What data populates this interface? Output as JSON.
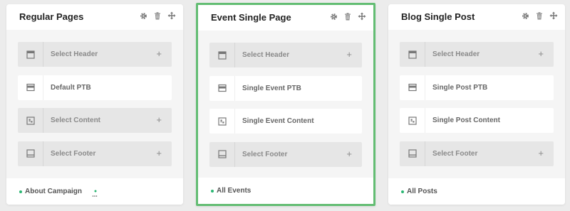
{
  "accent_color": "#63bd73",
  "link_dot_color": "#2bb673",
  "cards": [
    {
      "title": "Regular Pages",
      "rows": [
        {
          "label": "Select Header",
          "state": "empty",
          "icon": "header-layout-icon"
        },
        {
          "label": "Default PTB",
          "state": "filled",
          "icon": "ptb-layout-icon"
        },
        {
          "label": "Select Content",
          "state": "empty",
          "icon": "content-layout-icon"
        },
        {
          "label": "Select Footer",
          "state": "empty",
          "icon": "footer-layout-icon"
        }
      ],
      "footer_link": "About Campaign",
      "plus": "+"
    },
    {
      "title": "Event Single Page",
      "rows": [
        {
          "label": "Select Header",
          "state": "empty",
          "icon": "header-layout-icon"
        },
        {
          "label": "Single Event PTB",
          "state": "filled",
          "icon": "ptb-layout-icon"
        },
        {
          "label": "Single Event Content",
          "state": "filled",
          "icon": "content-layout-icon"
        },
        {
          "label": "Select Footer",
          "state": "empty",
          "icon": "footer-layout-icon"
        }
      ],
      "footer_link": "All Events",
      "plus": "+"
    },
    {
      "title": "Blog Single Post",
      "rows": [
        {
          "label": "Select Header",
          "state": "empty",
          "icon": "header-layout-icon"
        },
        {
          "label": "Single Post PTB",
          "state": "filled",
          "icon": "ptb-layout-icon"
        },
        {
          "label": "Single Post Content",
          "state": "filled",
          "icon": "content-layout-icon"
        },
        {
          "label": "Select Footer",
          "state": "empty",
          "icon": "footer-layout-icon"
        }
      ],
      "footer_link": "All Posts",
      "plus": "+"
    }
  ]
}
